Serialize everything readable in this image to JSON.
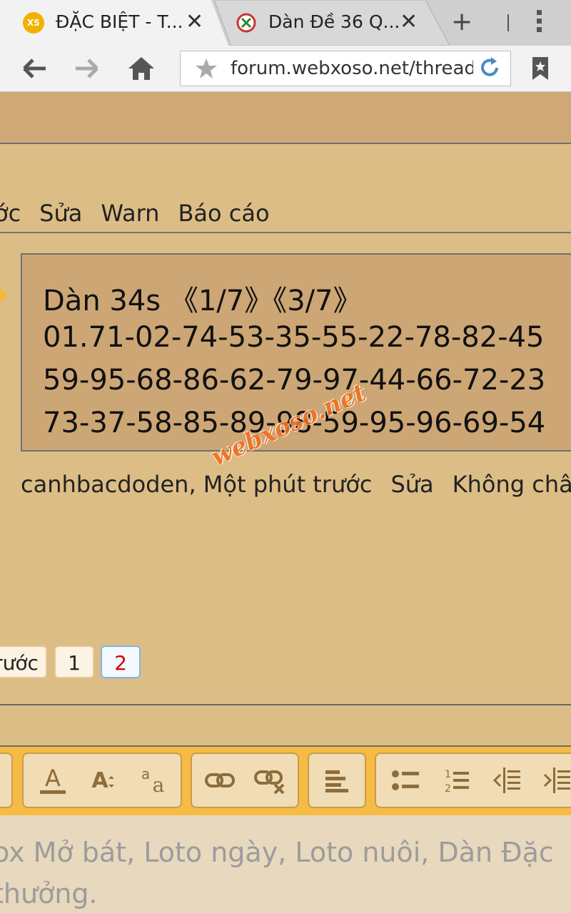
{
  "browser": {
    "tabs": [
      {
        "title": "ĐẶC BIỆT - T...",
        "favicon": "XS",
        "active": true
      },
      {
        "title": "Dàn Đề 36 Q...",
        "active": false
      }
    ],
    "url": "forum.webxoso.net/threads/"
  },
  "post_actions": [
    "ớc",
    "Sửa",
    "Warn",
    "Báo cáo"
  ],
  "quote": {
    "lines": [
      "Dàn 34s 《1/7》《3/7》",
      "01.71-02-74-53-35-55-22-78-82-45",
      "59-95-68-86-62-79-97-44-66-72-23",
      "73-37-58-85-89-98-59-95-96-69-54"
    ]
  },
  "watermark": "webxoso.net",
  "meta": {
    "author_time": "canhbacdoden, Một phút trước",
    "edit": "Sửa",
    "third": "Không châ"
  },
  "pagination": {
    "prev": "rước",
    "pages": [
      "1",
      "2"
    ],
    "current": "2"
  },
  "editor": {
    "placeholder_lines": [
      "ox Mở bát, Loto ngày, Loto nuôi, Dàn Đặc",
      "thưởng."
    ]
  },
  "colors": {
    "page_bg": "#dcbd86",
    "header_band": "#cfa877",
    "quote_bg": "#cda675",
    "editor_bar": "#f5bb45",
    "current_page": "#d40000",
    "watermark": "#f0701e"
  }
}
